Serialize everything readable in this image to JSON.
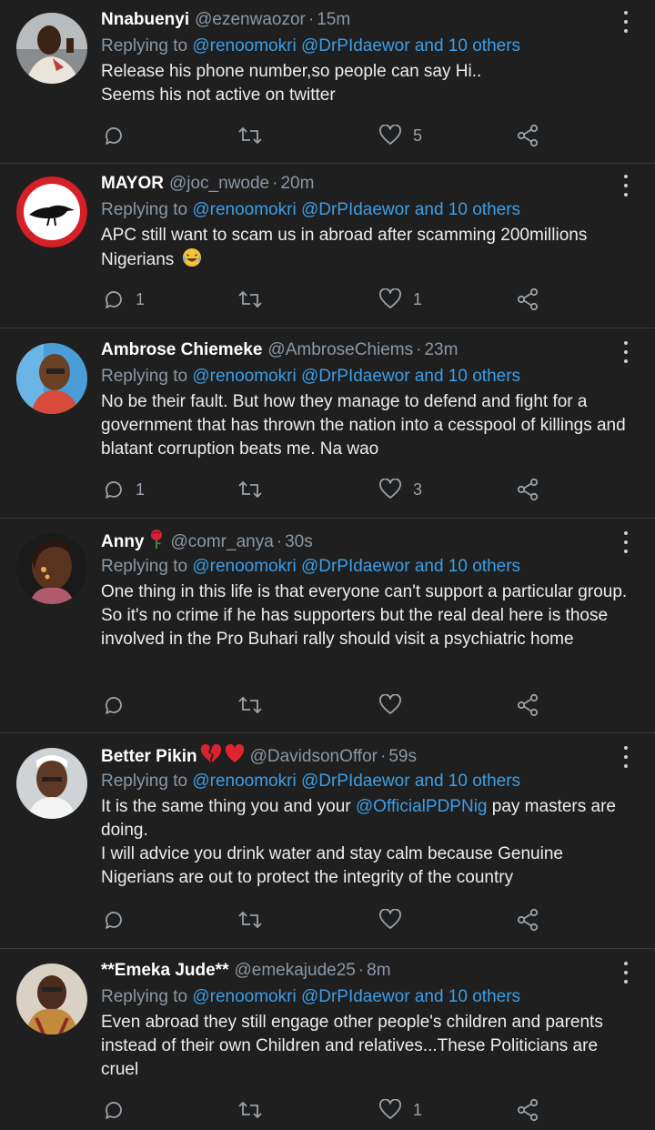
{
  "colors": {
    "background": "#1f1f1f",
    "mention": "#3c9ee6",
    "muted": "#8b98a5",
    "divider": "#3a3a3a"
  },
  "tweets": [
    {
      "name": "Nnabuenyi",
      "handle": "@ezenwaozor",
      "dot": "·",
      "time": "15m",
      "reply_prefix": "Replying to",
      "reply_mentions": "@renoomokri @DrPIdaewor and 10 others",
      "text": "Release his phone number,so people can say Hi..\nSeems his not active on twitter",
      "reply_count": "",
      "retweet_count": "",
      "like_count": "5"
    },
    {
      "name": "MAYOR",
      "handle": "@joc_nwode",
      "dot": "·",
      "time": "20m",
      "reply_prefix": "Replying to",
      "reply_mentions": "@renoomokri @DrPIdaewor and 10 others",
      "text": "APC still want to scam us in abroad after scamming 200millions Nigerians",
      "emoji": "laughing-emoji",
      "reply_count": "1",
      "retweet_count": "",
      "like_count": "1"
    },
    {
      "name": "Ambrose Chiemeke",
      "handle": "@AmbroseChiems",
      "dot": "·",
      "time": "23m",
      "reply_prefix": "Replying to",
      "reply_mentions": "@renoomokri @DrPIdaewor and 10 others",
      "text": "No be their fault. But how they manage to defend and fight for a government that has thrown the nation into a cesspool of killings and blatant corruption beats me. Na wao",
      "reply_count": "1",
      "retweet_count": "",
      "like_count": "3"
    },
    {
      "name": "Anny",
      "name_emoji": "rose-emoji",
      "handle": "@comr_anya",
      "dot": "·",
      "time": "30s",
      "reply_prefix": "Replying to",
      "reply_mentions": "@renoomokri @DrPIdaewor and 10 others",
      "text": "One thing in this life is that everyone can't support a particular group. So it's no crime if he has supporters but the real deal here is those involved in the Pro Buhari rally should visit a psychiatric home",
      "reply_count": "",
      "retweet_count": "",
      "like_count": ""
    },
    {
      "name": "Better Pikin",
      "name_emoji": "broken-heart-and-heart-emoji",
      "handle": "@DavidsonOffor",
      "dot": "·",
      "time": "59s",
      "reply_prefix": "Replying to",
      "reply_mentions": "@renoomokri @DrPIdaewor and 10 others",
      "text_before": "It is the same thing you and your ",
      "text_link": " @OfficialPDPNig",
      "text_after": " pay masters are doing.\nI will advice you drink water and stay calm because Genuine Nigerians are out to protect the integrity of the country",
      "reply_count": "",
      "retweet_count": "",
      "like_count": ""
    },
    {
      "name": "**Emeka Jude**",
      "handle": "@emekajude25",
      "dot": "·",
      "time": "8m",
      "reply_prefix": "Replying to",
      "reply_mentions": "@renoomokri @DrPIdaewor and 10 others",
      "text": "Even abroad they still engage other people's children and parents instead of their own Children and relatives...These Politicians are cruel",
      "reply_count": "",
      "retweet_count": "",
      "like_count": "1"
    }
  ]
}
